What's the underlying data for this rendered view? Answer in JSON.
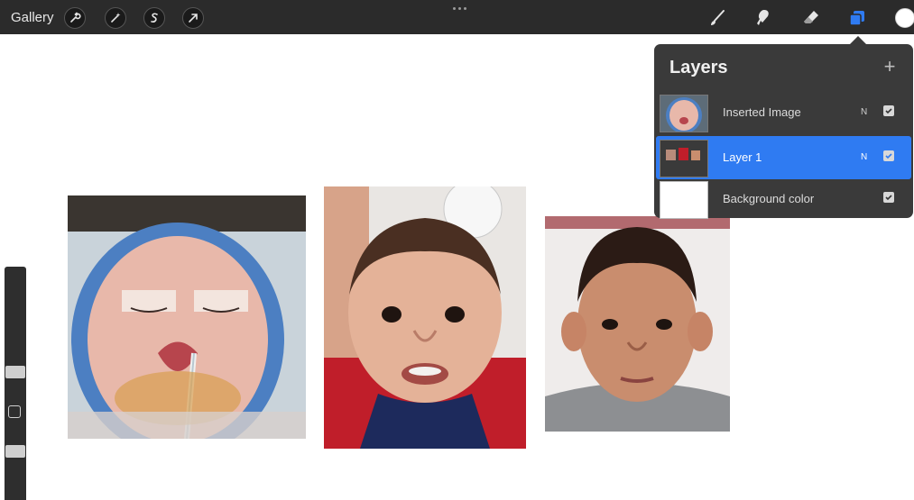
{
  "toolbar": {
    "gallery_label": "Gallery",
    "left_tools": [
      "wrench-icon",
      "magic-wand-icon",
      "selection-icon",
      "transform-arrow-icon"
    ],
    "more_icon": "ellipsis-icon",
    "right_tools": [
      "brush-icon",
      "smudge-icon",
      "eraser-icon",
      "layers-icon"
    ],
    "active_tool": "layers-icon",
    "active_color": "#ffffff",
    "accent": "#2f7bf2"
  },
  "layers_panel": {
    "title": "Layers",
    "add_icon": "plus-icon",
    "layers": [
      {
        "name": "Inserted Image",
        "blend_mode": "N",
        "visible": true,
        "selected": false
      },
      {
        "name": "Layer 1",
        "blend_mode": "N",
        "visible": true,
        "selected": true
      },
      {
        "name": "Background color",
        "blend_mode": "",
        "visible": true,
        "selected": false
      }
    ]
  },
  "canvas": {
    "images": [
      "infant-cleft-lip-photo",
      "toddler-face-photo",
      "child-face-photo"
    ]
  }
}
